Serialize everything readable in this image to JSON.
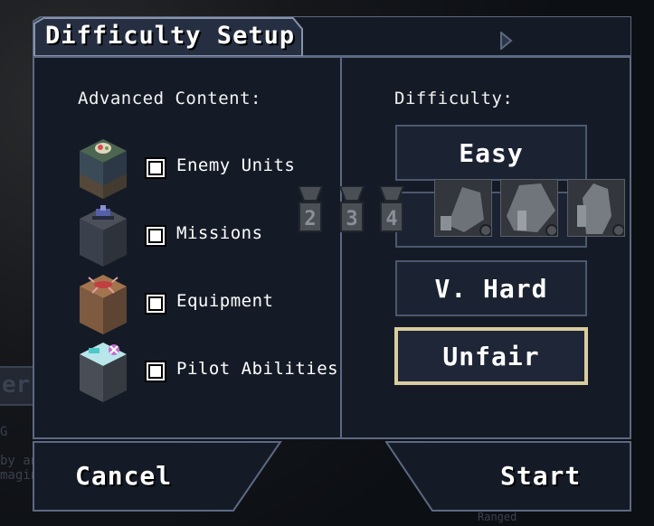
{
  "dialog": {
    "title": "Difficulty Setup"
  },
  "advanced_content": {
    "heading": "Advanced Content:",
    "items": [
      {
        "label": "Enemy Units",
        "checked": true,
        "icon": "enemy-cube-icon"
      },
      {
        "label": "Missions",
        "checked": true,
        "icon": "mission-cube-icon"
      },
      {
        "label": "Equipment",
        "checked": true,
        "icon": "equipment-cube-icon"
      },
      {
        "label": "Pilot Abilities",
        "checked": true,
        "icon": "pilot-cube-icon"
      }
    ]
  },
  "difficulty": {
    "heading": "Difficulty:",
    "options": [
      "Easy",
      "",
      "V. Hard",
      "Unfair"
    ],
    "selected": "Unfair",
    "medal_numbers": [
      "2",
      "3",
      "4"
    ]
  },
  "footer": {
    "cancel_label": "Cancel",
    "start_label": "Start"
  },
  "colors": {
    "panel_bg": "#151b26",
    "panel_border": "#5c6982",
    "selected_border": "#d9cc9e"
  }
}
